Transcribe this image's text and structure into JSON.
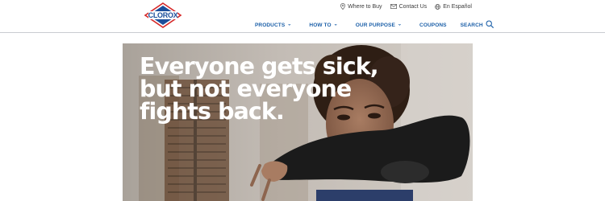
{
  "brand": {
    "name": "CLOROX"
  },
  "utility_nav": {
    "where_to_buy": "Where to Buy",
    "contact_us": "Contact Us",
    "language": "En Español"
  },
  "main_nav": {
    "products": "PRODUCTS",
    "how_to": "HOW TO",
    "our_purpose": "OUR PURPOSE",
    "coupons": "COUPONS",
    "search": "SEARCH"
  },
  "hero": {
    "headline": "Everyone gets sick,\nbut not everyone\nfights back."
  },
  "colors": {
    "nav_blue": "#1b5fa8",
    "logo_blue": "#1b4e9b",
    "logo_red": "#d62828"
  }
}
